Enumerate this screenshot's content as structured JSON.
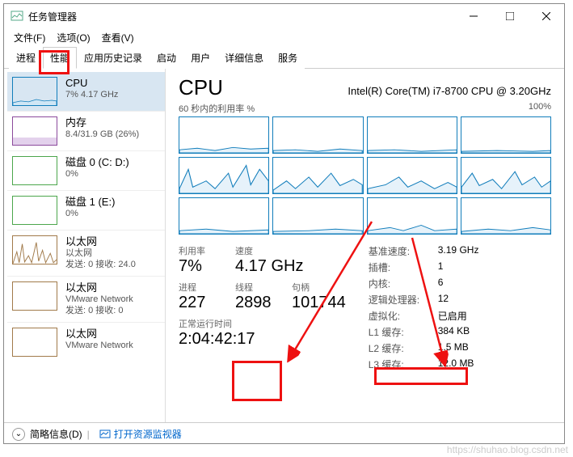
{
  "window": {
    "title": "任务管理器"
  },
  "menu": {
    "file": "文件(F)",
    "options": "选项(O)",
    "view": "查看(V)"
  },
  "tabs": {
    "processes": "进程",
    "performance": "性能",
    "history": "应用历史记录",
    "startup": "启动",
    "users": "用户",
    "details": "详细信息",
    "services": "服务"
  },
  "sidebar": [
    {
      "name": "CPU",
      "sub": "7% 4.17 GHz",
      "kind": "cpu"
    },
    {
      "name": "内存",
      "sub": "8.4/31.9 GB (26%)",
      "kind": "mem"
    },
    {
      "name": "磁盘 0 (C: D:)",
      "sub": "0%",
      "kind": "disk"
    },
    {
      "name": "磁盘 1 (E:)",
      "sub": "0%",
      "kind": "disk"
    },
    {
      "name": "以太网",
      "sub": "以太网\n发送: 0 接收: 24.0",
      "kind": "net"
    },
    {
      "name": "以太网",
      "sub": "VMware Network\n发送: 0 接收: 0",
      "kind": "net"
    },
    {
      "name": "以太网",
      "sub": "VMware Network",
      "kind": "net"
    }
  ],
  "main": {
    "title": "CPU",
    "model": "Intel(R) Core(TM) i7-8700 CPU @ 3.20GHz",
    "chart_label_left": "60 秒内的利用率 %",
    "chart_label_right": "100%",
    "stats_left": [
      {
        "label": "利用率",
        "value": "7%"
      },
      {
        "label": "速度",
        "value": "4.17 GHz"
      }
    ],
    "stats_left2": [
      {
        "label": "进程",
        "value": "227"
      },
      {
        "label": "线程",
        "value": "2898"
      },
      {
        "label": "句柄",
        "value": "101744"
      }
    ],
    "uptime": {
      "label": "正常运行时间",
      "value": "2:04:42:17"
    },
    "stats_right": [
      {
        "k": "基准速度:",
        "v": "3.19 GHz"
      },
      {
        "k": "插槽:",
        "v": "1"
      },
      {
        "k": "内核:",
        "v": "6"
      },
      {
        "k": "逻辑处理器:",
        "v": "12"
      },
      {
        "k": "虚拟化:",
        "v": "已启用"
      },
      {
        "k": "L1 缓存:",
        "v": "384 KB"
      },
      {
        "k": "L2 缓存:",
        "v": "1.5 MB"
      },
      {
        "k": "L3 缓存:",
        "v": "12.0 MB"
      }
    ]
  },
  "footer": {
    "brief": "简略信息(D)",
    "monitor": "打开资源监视器"
  },
  "watermark": "https://shuhao.blog.csdn.net",
  "chart_data": {
    "type": "area",
    "title": "CPU 利用率按逻辑处理器",
    "ylabel": "利用率 %",
    "xlabel": "60 秒",
    "ylim": [
      0,
      100
    ],
    "series_count": 12,
    "note": "12 small multiples, each logical processor ~5-40% with occasional spikes; processors 5-8 show higher spiky activity"
  }
}
